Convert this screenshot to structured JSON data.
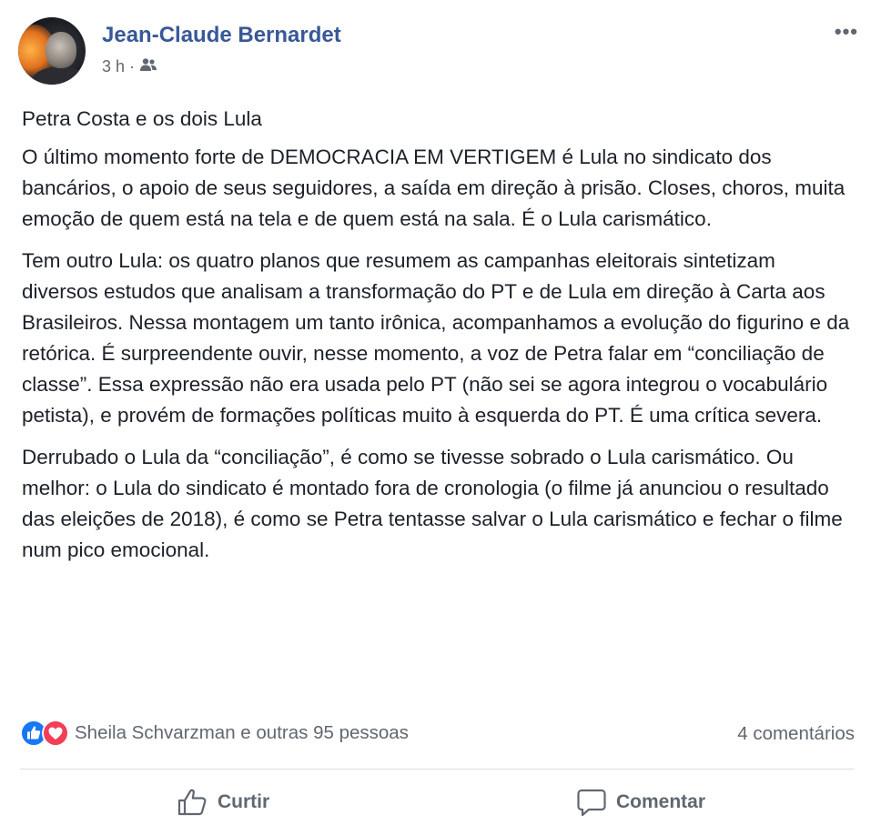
{
  "post": {
    "author": "Jean-Claude Bernardet",
    "time": "3 h",
    "separator": "·",
    "audience_icon": "friends-icon",
    "more_label": "•••",
    "title": "Petra Costa e os dois Lula",
    "paragraphs": [
      "O último momento forte de DEMOCRACIA EM VERTIGEM é Lula no sindicato dos bancários, o apoio de seus seguidores, a saída em direção à prisão. Closes, choros, muita emoção de quem está na tela e de quem está na sala. É o Lula carismático.",
      "Tem outro Lula: os quatro planos que resumem as campanhas eleitorais sintetizam diversos estudos que analisam a transformação do PT e de Lula em direção à Carta aos Brasileiros. Nessa montagem um tanto irônica, acompanhamos a evolução do figurino e da retórica. É surpreendente ouvir, nesse momento, a voz de Petra falar em “conciliação de classe”. Essa expressão não era usada pelo PT (não sei se agora integrou o vocabulário petista), e provém de formações políticas muito à esquerda do PT. É uma crítica severa.",
      "Derrubado o Lula da “conciliação”, é como se tivesse sobrado o Lula carismático. Ou melhor: o Lula do sindicato é montado fora de cronologia (o filme já anunciou o resultado das eleições de 2018), é como se Petra tentasse salvar o Lula carismático e fechar o filme num pico emocional."
    ]
  },
  "reactions": {
    "icons": [
      "like-icon",
      "love-icon"
    ],
    "summary": "Sheila Schvarzman e outras 95 pessoas",
    "comments": "4 comentários"
  },
  "actions": {
    "like_label": "Curtir",
    "comment_label": "Comentar"
  },
  "colors": {
    "author_link": "#385898",
    "text": "#1d2129",
    "secondary": "#616770",
    "like_blue": "#1877f2",
    "love_red": "#f33e58",
    "divider": "#dadde1"
  }
}
